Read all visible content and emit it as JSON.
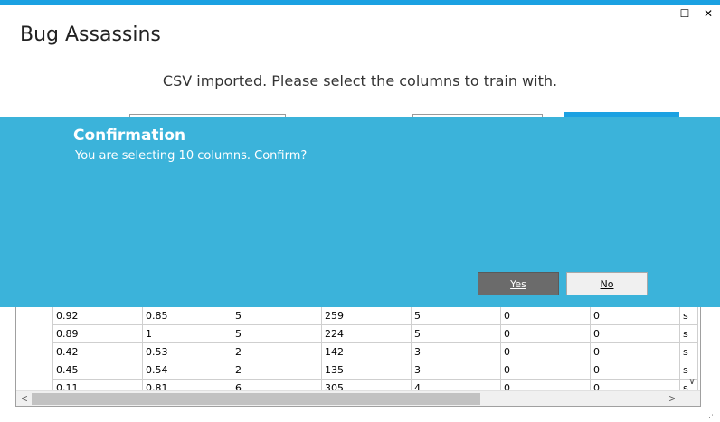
{
  "window": {
    "title": "Bug Assassins",
    "controls": {
      "minimize": "–",
      "maximize": "☐",
      "close": "✕"
    }
  },
  "main": {
    "instruction": "CSV imported. Please select the columns to train with."
  },
  "dialog": {
    "title": "Confirmation",
    "message": "You are selecting 10 columns. Confirm?",
    "yes_label": "Yes",
    "no_label": "No"
  },
  "grid": {
    "rows": [
      [
        "0.92",
        "0.85",
        "5",
        "259",
        "5",
        "0",
        "0",
        "s"
      ],
      [
        "0.89",
        "1",
        "5",
        "224",
        "5",
        "0",
        "0",
        "s"
      ],
      [
        "0.42",
        "0.53",
        "2",
        "142",
        "3",
        "0",
        "0",
        "s"
      ],
      [
        "0.45",
        "0.54",
        "2",
        "135",
        "3",
        "0",
        "0",
        "s"
      ],
      [
        "0.11",
        "0.81",
        "6",
        "305",
        "4",
        "0",
        "0",
        "s"
      ]
    ],
    "scroll": {
      "left": "<",
      "right": ">",
      "down": "∨"
    }
  },
  "colors": {
    "accent": "#1ba1e2",
    "dialog_bg": "#3bb3da",
    "yes_button": "#6b6b6b"
  }
}
